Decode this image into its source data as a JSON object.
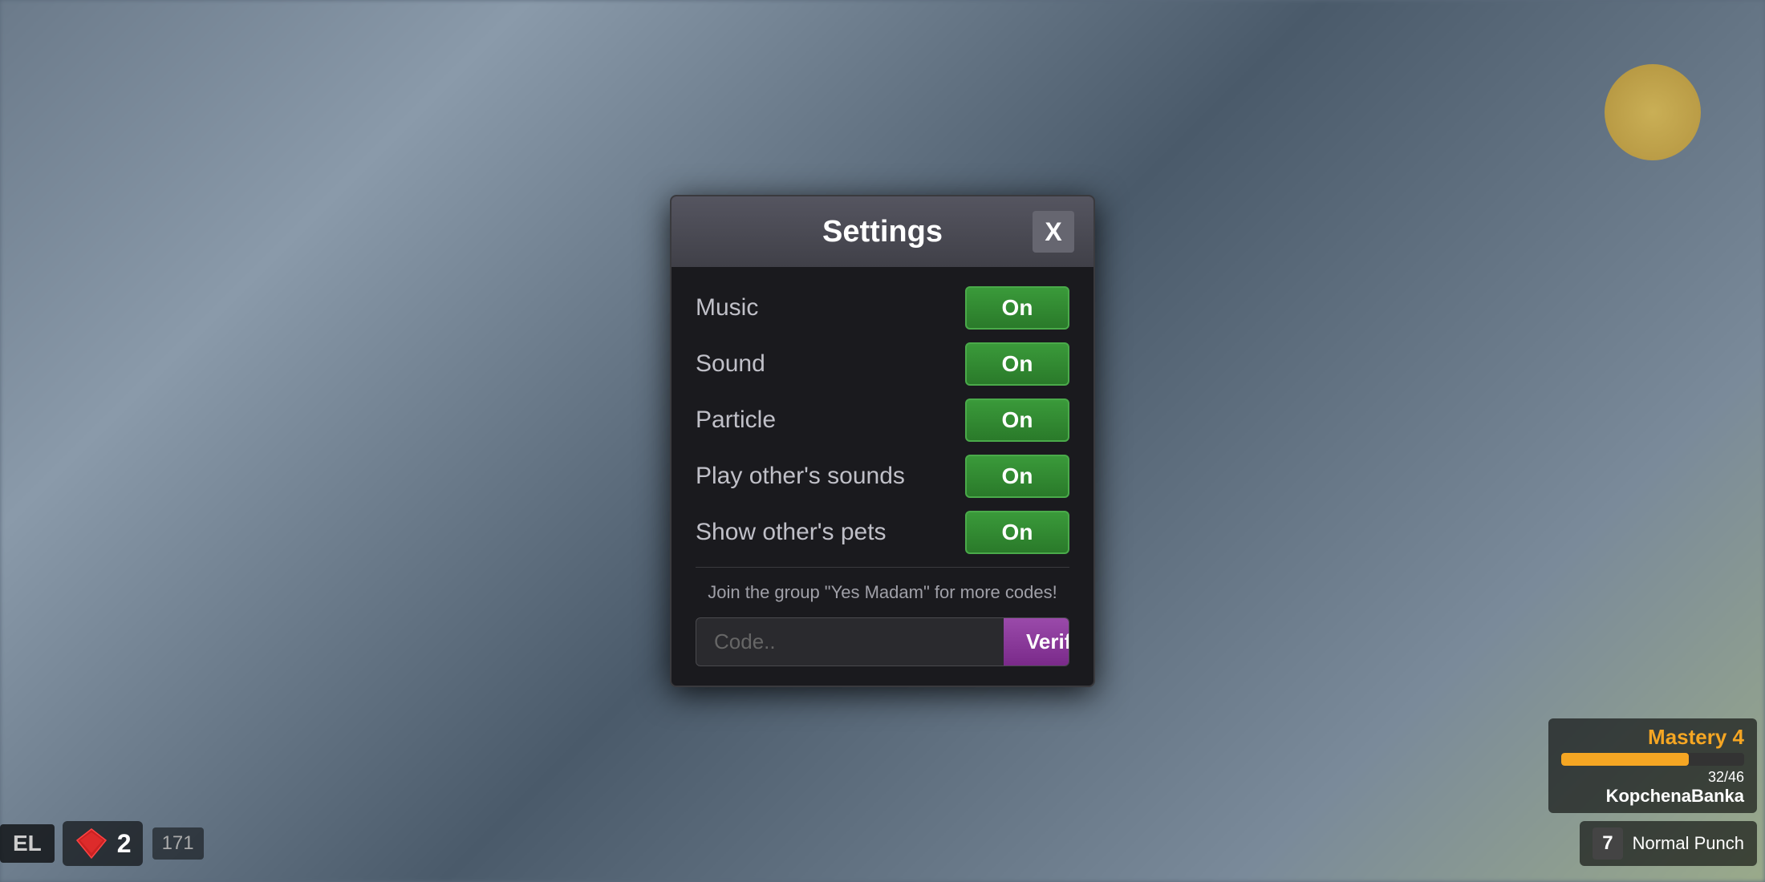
{
  "background": {
    "description": "Blurred game background"
  },
  "hud": {
    "level_label": "EL",
    "currency_value": "171",
    "currency_amount": "2",
    "mastery_title": "Mastery 4",
    "mastery_current": 32,
    "mastery_max": 46,
    "mastery_progress_text": "32/46",
    "mastery_player_name": "KopchenaBanka",
    "action_key": "7",
    "action_name": "Normal Punch"
  },
  "modal": {
    "title": "Settings",
    "close_label": "X",
    "settings": [
      {
        "id": "music",
        "label": "Music",
        "value": "On"
      },
      {
        "id": "sound",
        "label": "Sound",
        "value": "On"
      },
      {
        "id": "particle",
        "label": "Particle",
        "value": "On"
      },
      {
        "id": "play-others-sounds",
        "label": "Play other's sounds",
        "value": "On"
      },
      {
        "id": "show-others-pets",
        "label": "Show other's pets",
        "value": "On"
      }
    ],
    "promo_text": "Join the group \"Yes Madam\" for more codes!",
    "code_placeholder": "Code..",
    "verify_label": "Verify"
  }
}
